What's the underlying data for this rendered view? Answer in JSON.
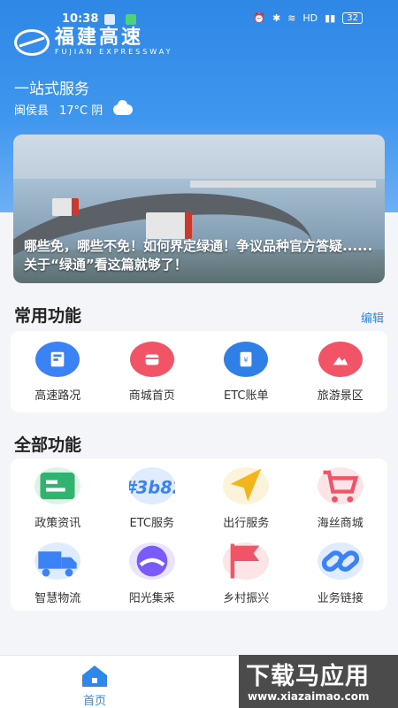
{
  "status_bar": {
    "time": "10:38",
    "hd_label": "HD",
    "battery": "32"
  },
  "brand": {
    "name_cn": "福建高速",
    "name_en": "FUJIAN EXPRESSWAY"
  },
  "header": {
    "subtitle": "一站式服务",
    "location": "闽侯县",
    "weather": "17°C 阴"
  },
  "banner": {
    "caption": "哪些免，哪些不免！如何界定绿通！争议品种官方答疑......关于“绿通”看这篇就够了！"
  },
  "common": {
    "title": "常用功能",
    "edit_label": "编辑",
    "items": [
      {
        "label": "高速路况",
        "icon": "road-map-icon",
        "color": "#3b82f6"
      },
      {
        "label": "商城首页",
        "icon": "shop-icon",
        "color": "#f25467"
      },
      {
        "label": "ETC账单",
        "icon": "etc-bill-icon",
        "color": "#2f7fe6"
      },
      {
        "label": "旅游景区",
        "icon": "scenery-icon",
        "color": "#f25467"
      }
    ]
  },
  "all": {
    "title": "全部功能",
    "items": [
      {
        "label": "政策资讯",
        "icon": "news-card-icon",
        "color": "#2fb36f"
      },
      {
        "label": "ETC服务",
        "icon": "etc-icon",
        "color": "#3b82f6"
      },
      {
        "label": "出行服务",
        "icon": "navigation-arrow-icon",
        "color": "#f2b51c"
      },
      {
        "label": "海丝商城",
        "icon": "cart-icon",
        "color": "#f25467"
      },
      {
        "label": "智慧物流",
        "icon": "truck-icon",
        "color": "#3b82f6"
      },
      {
        "label": "阳光集采",
        "icon": "sun-icon",
        "color": "#7a5af8"
      },
      {
        "label": "乡村振兴",
        "icon": "flag-icon",
        "color": "#f25467"
      },
      {
        "label": "业务链接",
        "icon": "link-icon",
        "color": "#3b82f6"
      }
    ]
  },
  "tabbar": {
    "home_label": "首页"
  },
  "watermark": {
    "big": "下载马应用",
    "small": "www.xiazaimao.com"
  }
}
